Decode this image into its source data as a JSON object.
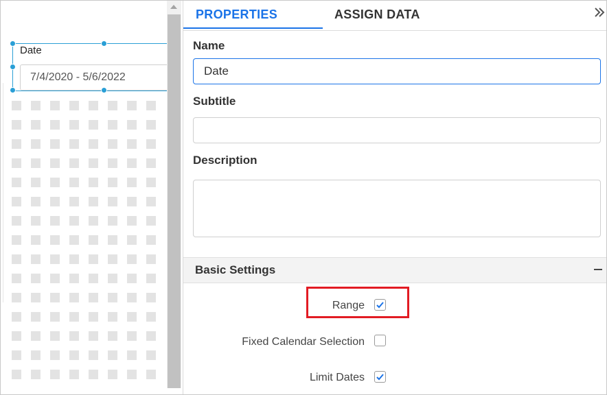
{
  "canvas": {
    "widget": {
      "title": "Date",
      "date_range_value": "7/4/2020 - 5/6/2022"
    }
  },
  "panel": {
    "tabs": [
      {
        "label": "PROPERTIES",
        "active": true
      },
      {
        "label": "ASSIGN DATA",
        "active": false
      }
    ],
    "collapse_icon": "double-chevron-right-icon",
    "fields": {
      "name_label": "Name",
      "name_value": "Date",
      "subtitle_label": "Subtitle",
      "subtitle_value": "",
      "description_label": "Description",
      "description_value": ""
    },
    "basic_settings": {
      "title": "Basic Settings",
      "toggle_icon": "minus-icon",
      "items": [
        {
          "label": "Range",
          "checked": true
        },
        {
          "label": "Fixed Calendar Selection",
          "checked": false
        },
        {
          "label": "Limit Dates",
          "checked": true
        }
      ]
    }
  },
  "colors": {
    "accent": "#1a73e8",
    "selection": "#2a9fd6",
    "highlight": "#e21b23"
  }
}
